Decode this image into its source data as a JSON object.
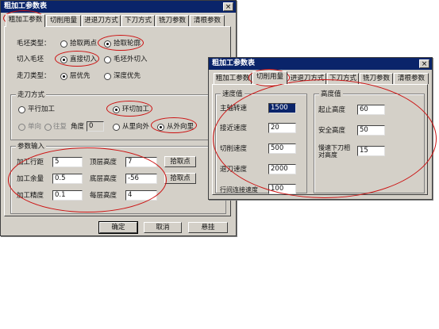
{
  "window1": {
    "title": "粗加工参数表",
    "close": "×",
    "tabs": [
      "粗加工参数",
      "切削用量",
      "进退刀方式",
      "下刀方式",
      "铣刀参数",
      "清根参数"
    ],
    "blank_type": {
      "label": "毛坯类型：",
      "options": [
        "拾取两点",
        "拾取轮廓"
      ],
      "selected": 1
    },
    "cut_in": {
      "label": "切入毛坯",
      "options": [
        "直接切入",
        "毛坯外切入"
      ],
      "selected": 0
    },
    "path_type": {
      "label": "走刀类型：",
      "options": [
        "层优先",
        "深度优先"
      ],
      "selected": 0
    },
    "feed_group": {
      "legend": "走刀方式",
      "parallel": "平行加工",
      "ring": "环切加工",
      "oneway": "单向",
      "back": "往复",
      "angle_label": "角度",
      "angle_value": "0",
      "inside_out": "从里向外",
      "outside_in": "从外向里",
      "selected_mode": "ring",
      "selected_dir": "outside_in"
    },
    "param_group": {
      "legend": "参数输入",
      "rows": [
        {
          "label": "加工行距",
          "value": "5"
        },
        {
          "label": "加工余量",
          "value": "0.5"
        },
        {
          "label": "加工精度",
          "value": "0.1"
        }
      ],
      "rows_right": [
        {
          "label": "顶层高度",
          "value": "7"
        },
        {
          "label": "底层高度",
          "value": "-56"
        },
        {
          "label": "每层高度",
          "value": "4"
        }
      ],
      "pick_buttons": [
        "拾取点",
        "拾取点"
      ]
    },
    "buttons": {
      "ok": "确定",
      "cancel": "取消",
      "hide": "悬挂"
    }
  },
  "window2": {
    "title": "粗加工参数表",
    "close": "×",
    "tabs": [
      "粗加工参数",
      "切削用量",
      "进退刀方式",
      "下刀方式",
      "铣刀参数",
      "清根参数"
    ],
    "speed_group": {
      "legend": "速度值",
      "rows": [
        {
          "label": "主轴转速",
          "value": "1500"
        },
        {
          "label": "接近速度",
          "value": "20"
        },
        {
          "label": "切削速度",
          "value": "500"
        },
        {
          "label": "退刀速度",
          "value": "2000"
        },
        {
          "label": "行间连接速度",
          "value": "100"
        }
      ]
    },
    "height_group": {
      "legend": "高度值",
      "rows": [
        {
          "label": "起止高度",
          "value": "60"
        },
        {
          "label": "安全高度",
          "value": "50"
        },
        {
          "label": "慢速下刀相对高度",
          "value": "15"
        }
      ]
    }
  }
}
